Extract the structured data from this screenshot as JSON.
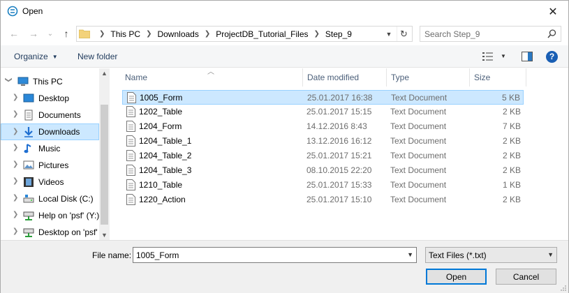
{
  "window": {
    "title": "Open",
    "close_glyph": "✕"
  },
  "nav": {
    "back_glyph": "←",
    "forward_glyph": "→",
    "recent_glyph": "⌄",
    "up_glyph": "↑",
    "breadcrumbs": [
      "This PC",
      "Downloads",
      "ProjectDB_Tutorial_Files",
      "Step_9"
    ],
    "search_placeholder": "Search Step_9"
  },
  "toolbar": {
    "organize_label": "Organize",
    "new_folder_label": "New folder",
    "help_label": "?"
  },
  "sidebar": {
    "items": [
      {
        "label": "This PC",
        "icon": "computer-icon"
      },
      {
        "label": "Desktop",
        "icon": "desktop-icon"
      },
      {
        "label": "Documents",
        "icon": "documents-icon"
      },
      {
        "label": "Downloads",
        "icon": "downloads-icon",
        "selected": true
      },
      {
        "label": "Music",
        "icon": "music-icon"
      },
      {
        "label": "Pictures",
        "icon": "pictures-icon"
      },
      {
        "label": "Videos",
        "icon": "videos-icon"
      },
      {
        "label": "Local Disk (C:)",
        "icon": "disk-icon"
      },
      {
        "label": "Help on 'psf' (Y:)",
        "icon": "network-drive-icon"
      },
      {
        "label": "Desktop on 'psf'",
        "icon": "network-drive-icon"
      }
    ]
  },
  "columns": [
    "Name",
    "Date modified",
    "Type",
    "Size"
  ],
  "files": [
    {
      "name": "1005_Form",
      "date": "25.01.2017 16:38",
      "type": "Text Document",
      "size": "5 KB",
      "selected": true
    },
    {
      "name": "1202_Table",
      "date": "25.01.2017 15:15",
      "type": "Text Document",
      "size": "2 KB"
    },
    {
      "name": "1204_Form",
      "date": "14.12.2016 8:43",
      "type": "Text Document",
      "size": "7 KB"
    },
    {
      "name": "1204_Table_1",
      "date": "13.12.2016 16:12",
      "type": "Text Document",
      "size": "2 KB"
    },
    {
      "name": "1204_Table_2",
      "date": "25.01.2017 15:21",
      "type": "Text Document",
      "size": "2 KB"
    },
    {
      "name": "1204_Table_3",
      "date": "08.10.2015 22:20",
      "type": "Text Document",
      "size": "2 KB"
    },
    {
      "name": "1210_Table",
      "date": "25.01.2017 15:33",
      "type": "Text Document",
      "size": "1 KB"
    },
    {
      "name": "1220_Action",
      "date": "25.01.2017 15:10",
      "type": "Text Document",
      "size": "2 KB"
    }
  ],
  "footer": {
    "file_name_label": "File name:",
    "file_name_value": "1005_Form",
    "file_type": "Text Files (*.txt)",
    "open_label": "Open",
    "cancel_label": "Cancel"
  },
  "colors": {
    "selection_bg": "#cce8ff",
    "selection_border": "#99d1ff",
    "accent": "#0078d7",
    "header_text": "#4c607a"
  }
}
